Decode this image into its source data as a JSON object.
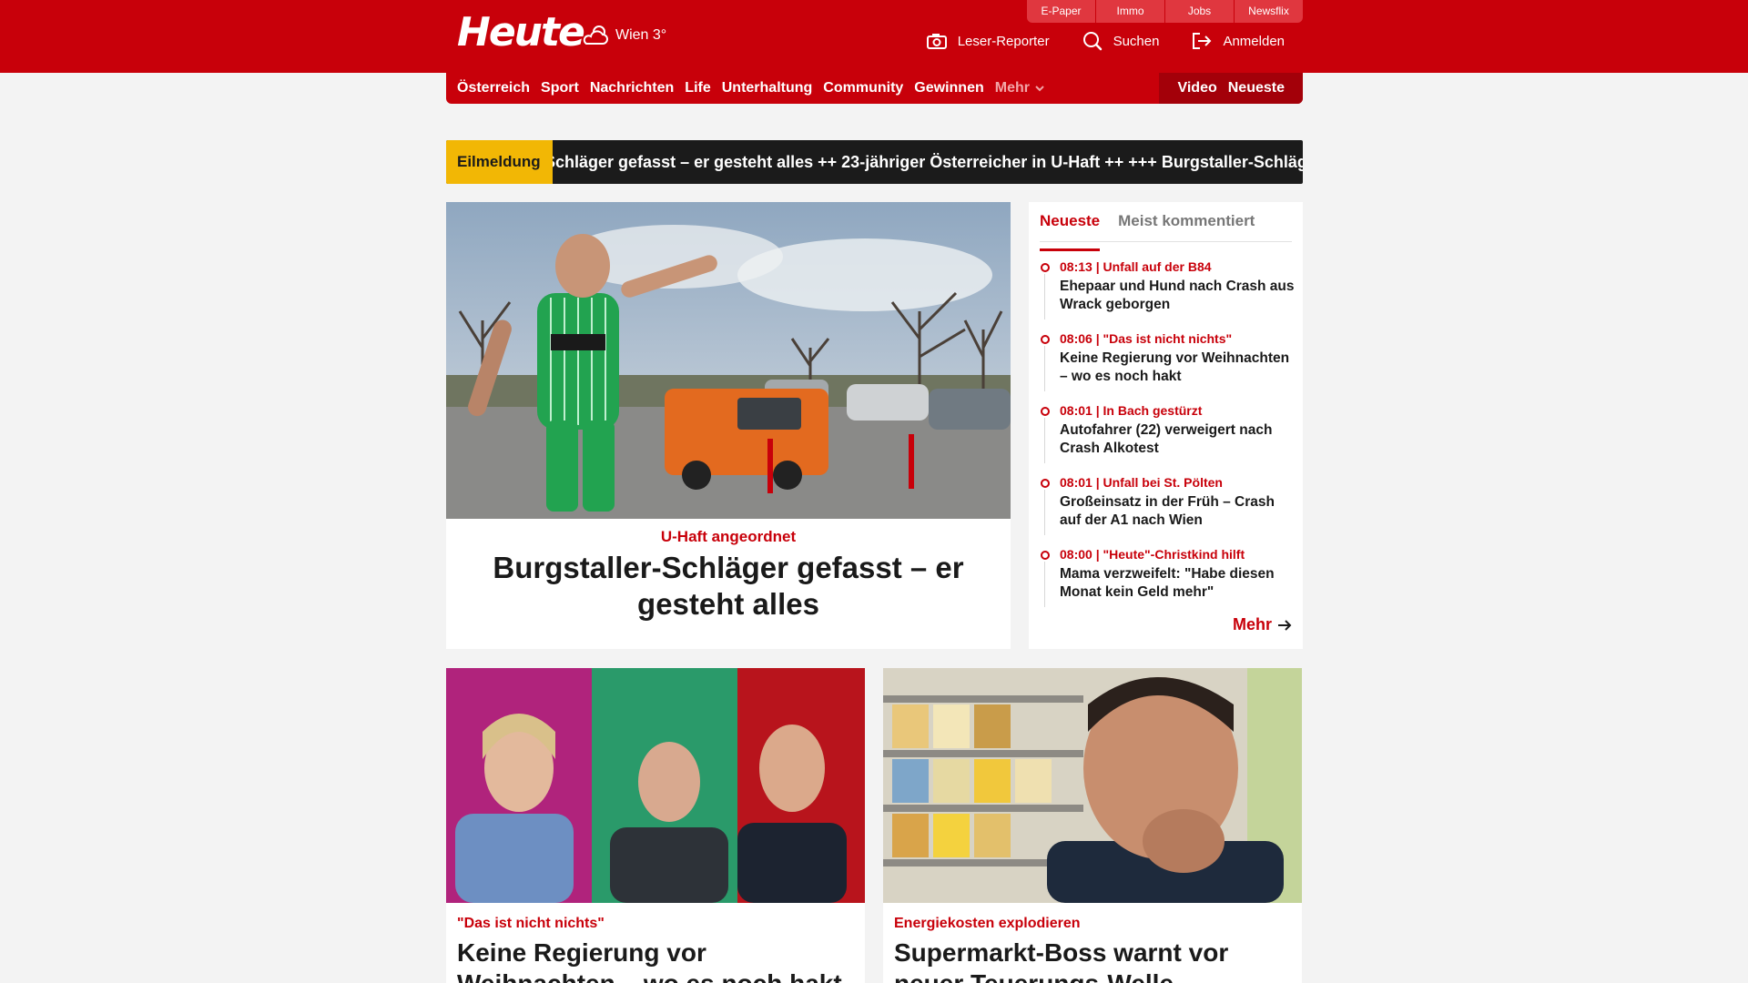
{
  "header": {
    "logo": "Heute",
    "weather": "Wien 3°",
    "top_links": [
      "E-Paper",
      "Immo",
      "Jobs",
      "Newsflix"
    ],
    "actions": {
      "reporter": "Leser-Reporter",
      "search": "Suchen",
      "login": "Anmelden"
    }
  },
  "nav": {
    "items": [
      "Österreich",
      "Sport",
      "Nachrichten",
      "Life",
      "Unterhaltung",
      "Community",
      "Gewinnen"
    ],
    "more": "Mehr",
    "video": "Video",
    "latest": "Neueste"
  },
  "breaking": {
    "label": "Eilmeldung",
    "text": "er-Schläger gefasst – er gesteht alles ++ 23-jähriger Österreicher in U-Haft ++  +++  Burgstaller-Schläger"
  },
  "hero": {
    "kicker": "U-Haft angeordnet",
    "title": "Burgstaller-Schläger gefasst – er gesteht alles"
  },
  "sidebar": {
    "tabs": [
      "Neueste",
      "Meist kommentiert"
    ],
    "items": [
      {
        "meta": "08:13 | Unfall auf der B84",
        "title": "Ehepaar und Hund nach Crash aus Wrack geborgen"
      },
      {
        "meta": "08:06 | \"Das ist nicht nichts\"",
        "title": "Keine Regierung vor Weihnachten – wo es noch hakt"
      },
      {
        "meta": "08:01 | In Bach gestürzt",
        "title": "Autofahrer (22) verweigert nach Crash Alkotest"
      },
      {
        "meta": "08:01 | Unfall bei St. Pölten",
        "title": "Großeinsatz in der Früh – Crash auf der A1 nach Wien"
      },
      {
        "meta": "08:00 | \"Heute\"-Christkind hilft",
        "title": "Mama verzweifelt: \"Habe diesen Monat kein Geld mehr\""
      }
    ],
    "more": "Mehr"
  },
  "cards": [
    {
      "kicker": "\"Das ist nicht nichts\"",
      "title": "Keine Regierung vor Weihnachten – wo es noch hakt"
    },
    {
      "kicker": "Energiekosten explodieren",
      "title": "Supermarkt-Boss warnt vor neuer Teuerungs-Welle"
    }
  ],
  "colors": {
    "brand_red": "#c8000a",
    "breaking_yellow": "#f2b705",
    "background": "#f3f3f3"
  }
}
